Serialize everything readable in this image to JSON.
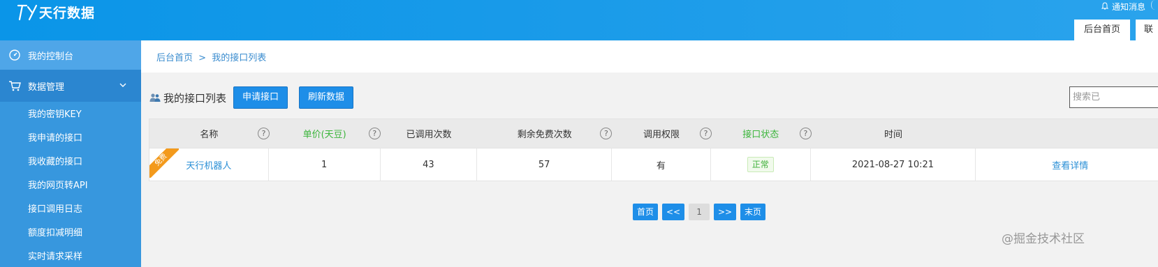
{
  "header": {
    "brand": "天行数据",
    "notice": "通知消息",
    "tabs": [
      "后台首页",
      "联"
    ],
    "colors": {
      "primary": "#1a9be9"
    }
  },
  "sidebar": {
    "dashboard": "我的控制台",
    "group": "数据管理",
    "items": [
      "我的密钥KEY",
      "我申请的接口",
      "我收藏的接口",
      "我的网页转API",
      "接口调用日志",
      "额度扣减明细",
      "实时请求采样"
    ]
  },
  "breadcrumb": {
    "home": "后台首页",
    "sep": ">",
    "current": "我的接口列表"
  },
  "toolbar": {
    "title": "我的接口列表",
    "apply_label": "申请接口",
    "refresh_label": "刷新数据",
    "search_placeholder": "搜索已"
  },
  "table": {
    "headers": [
      "名称",
      "单价(天豆)",
      "已调用次数",
      "剩余免费次数",
      "调用权限",
      "接口状态",
      "时间"
    ],
    "help_glyph": "?",
    "rows": [
      {
        "ribbon": "免费",
        "name": "天行机器人",
        "price": "1",
        "called": "43",
        "free_left": "57",
        "permission": "有",
        "status": "正常",
        "time": "2021-08-27 10:21",
        "action": "查看详情"
      }
    ]
  },
  "pagination": {
    "first": "首页",
    "prev": "<<",
    "current": "1",
    "next": ">>",
    "last": "末页"
  },
  "watermark": "@掘金技术社区"
}
